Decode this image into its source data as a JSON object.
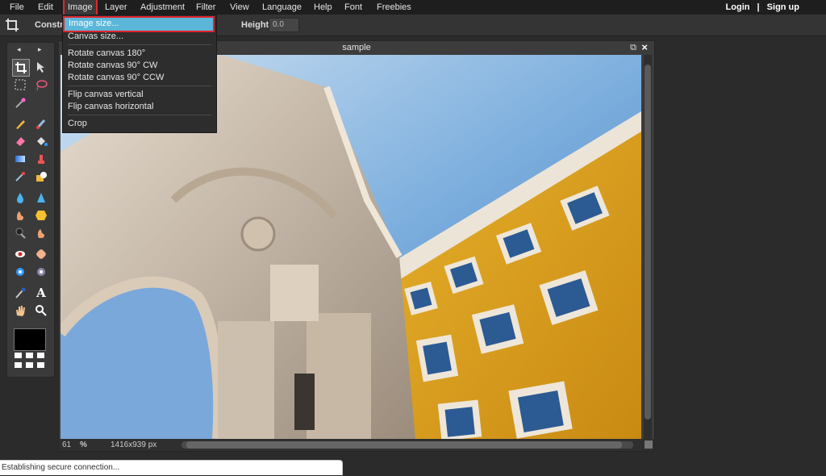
{
  "menubar": {
    "items": [
      "File",
      "Edit",
      "Image",
      "Layer",
      "Adjustment",
      "Filter",
      "View",
      "Language",
      "Help",
      "Font",
      "Freebies"
    ],
    "login": "Login",
    "separator": "|",
    "signup": "Sign up"
  },
  "options": {
    "constrain_label": "Constra",
    "height_label": "Height:",
    "height_value": "0.0"
  },
  "image_menu": {
    "image_size": "Image size...",
    "canvas_size": "Canvas size...",
    "rotate_180": "Rotate canvas 180°",
    "rotate_cw": "Rotate canvas 90° CW",
    "rotate_ccw": "Rotate canvas 90° CCW",
    "flip_vertical": "Flip canvas vertical",
    "flip_horizontal": "Flip canvas horizontal",
    "crop": "Crop"
  },
  "document": {
    "title": "sample",
    "zoom": "61",
    "zoom_unit": "%",
    "dimensions": "1416x939 px"
  },
  "toolbox": {
    "prev": "◂",
    "next": "▸",
    "tools": [
      "crop-icon",
      "move-icon",
      "marquee-icon",
      "lasso-icon",
      "magic-wand-icon",
      "pencil-icon",
      "brush-icon",
      "eraser-icon",
      "paint-bucket-icon",
      "gradient-icon",
      "clone-stamp-icon",
      "color-replace-icon",
      "shape-icon",
      "drop-icon",
      "sharpen-icon",
      "smudge-icon",
      "sponge-icon",
      "burn-icon",
      "dodge-icon",
      "red-eye-icon",
      "spot-heal-icon",
      "bloat-icon",
      "pinch-icon",
      "color-picker-icon",
      "type-icon",
      "hand-icon",
      "zoom-icon"
    ],
    "text_tool": "A"
  },
  "browser": {
    "status": "Establishing secure connection..."
  },
  "colors": {
    "accent_highlight": "#e0242d",
    "menu_selected": "#5bb6d8",
    "sky": "#6fa0d6",
    "facade_yellow": "#d9a11e"
  }
}
